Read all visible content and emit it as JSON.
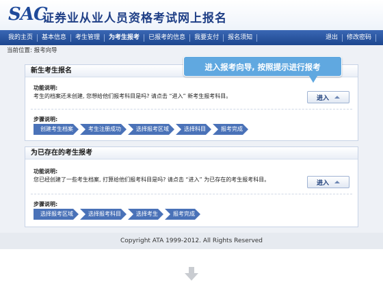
{
  "header": {
    "logo": "SAC",
    "title": "证券业从业人员资格考试网上报名"
  },
  "nav": {
    "items": [
      {
        "label": "我的主页"
      },
      {
        "label": "基本信息"
      },
      {
        "label": "考生管理"
      },
      {
        "label": "为考生报考"
      },
      {
        "label": "已报考的信息"
      },
      {
        "label": "我要支付"
      },
      {
        "label": "报名须知"
      }
    ],
    "active_index": 3,
    "right": [
      {
        "label": "退出"
      },
      {
        "label": "修改密码"
      }
    ]
  },
  "breadcrumb": {
    "prefix": "当前位置:",
    "current": "报考向导"
  },
  "tooltip": {
    "text": "进入报考向导, 按照提示进行报考"
  },
  "panel_new": {
    "title": "新生考生报名",
    "function_label": "功能说明:",
    "function_desc": "考生的档案还未创建, 您想给他们报考科目是吗? 请点击 “进入” 新考生报考科目。",
    "button_label": "进入",
    "steps_label": "步骤说明:",
    "steps": [
      "创建考生档案",
      "考生注册成功",
      "选择报考区域",
      "选择科目",
      "报考完成"
    ]
  },
  "panel_existing": {
    "title": "为已存在的考生报考",
    "function_label": "功能说明:",
    "function_desc": "您已经创建了一些考生档案, 打算给他们报考科目是吗? 请点击 “进入” 为已存在的考生报考科目。",
    "button_label": "进入",
    "steps_label": "步骤说明:",
    "steps": [
      "选择报考区域",
      "选择报考科目",
      "选择考生",
      "报考完成"
    ]
  },
  "footer": {
    "copyright": "Copyright ATA 1999-2012. All Rights Reserved"
  },
  "icons": {
    "down_arrow": "arrow-down-icon",
    "button_triangle": "triangle-up-icon"
  },
  "colors": {
    "nav_bg": "#2b58a3",
    "step_bg": "#4a72b8",
    "tooltip_bg": "#60a8e0"
  }
}
